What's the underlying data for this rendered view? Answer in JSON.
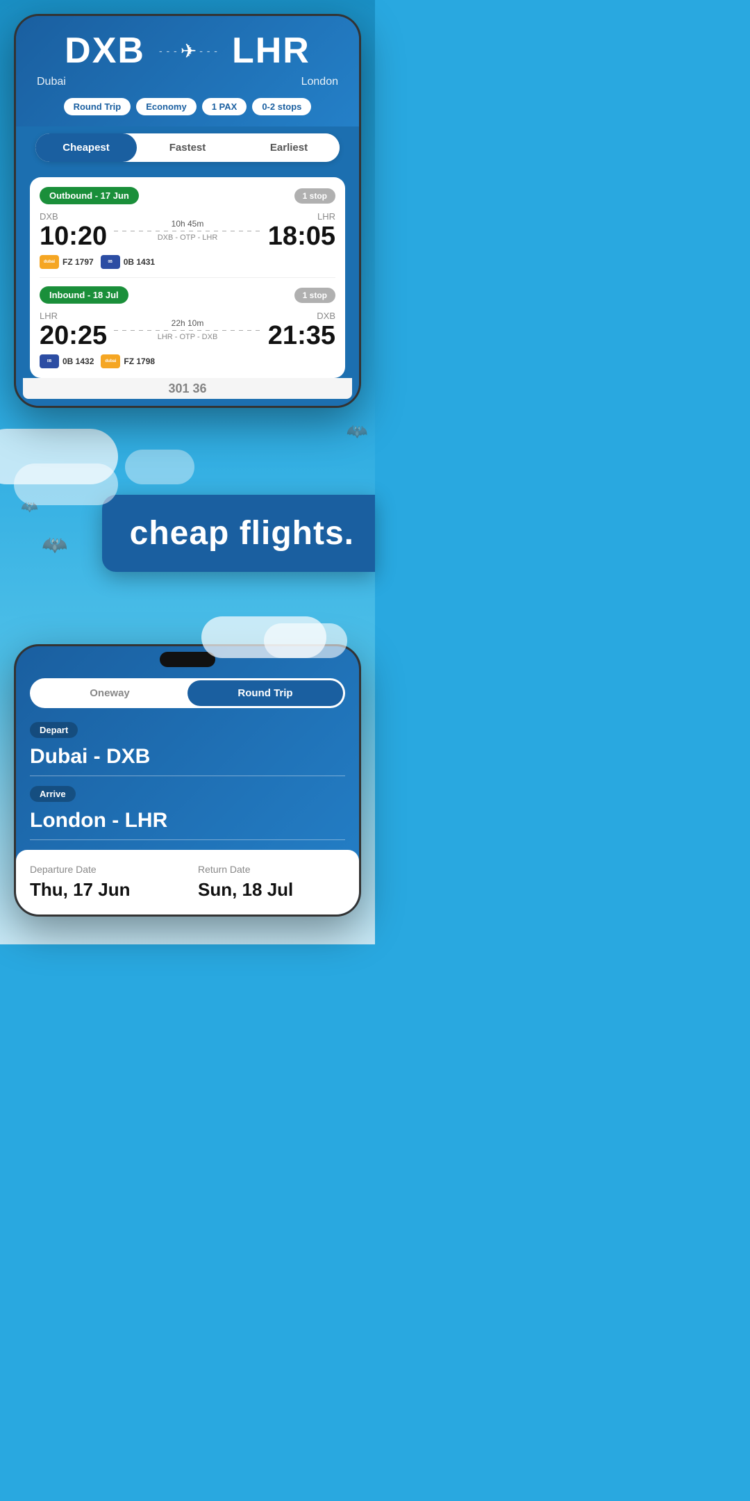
{
  "phone1": {
    "route": {
      "from_code": "DXB",
      "from_city": "Dubai",
      "to_code": "LHR",
      "to_city": "London"
    },
    "filters": {
      "trip_type": "Round Trip",
      "cabin": "Economy",
      "pax": "1 PAX",
      "stops": "0-2 stops"
    },
    "tabs": {
      "cheapest": "Cheapest",
      "fastest": "Fastest",
      "earliest": "Earliest"
    },
    "outbound": {
      "label": "Outbound - 17 Jun",
      "stop_badge": "1 stop",
      "from": "DXB",
      "to": "LHR",
      "depart_time": "10:20",
      "arrive_time": "18:05",
      "duration": "10h 45m",
      "route_via": "DXB - OTP - LHR",
      "airline1_code": "FZ 1797",
      "airline1_name": "dubai",
      "airline2_code": "0B 1431",
      "airline2_name": "blue"
    },
    "inbound": {
      "label": "Inbound - 18 Jul",
      "stop_badge": "1 stop",
      "from": "LHR",
      "to": "DXB",
      "depart_time": "20:25",
      "arrive_time": "21:35",
      "duration": "22h 10m",
      "route_via": "LHR - OTP - DXB",
      "airline1_code": "0B 1432",
      "airline1_name": "blue",
      "airline2_code": "FZ 1798",
      "airline2_name": "dubai"
    }
  },
  "banner": {
    "text": "cheap flights."
  },
  "phone2": {
    "toggle": {
      "oneway": "Oneway",
      "round_trip": "Round Trip"
    },
    "depart_label": "Depart",
    "depart_value": "Dubai - DXB",
    "arrive_label": "Arrive",
    "arrive_value": "London - LHR",
    "departure_date_label": "Departure Date",
    "departure_date_value": "Thu, 17 Jun",
    "return_date_label": "Return Date",
    "return_date_value": "Sun, 18 Jul"
  }
}
